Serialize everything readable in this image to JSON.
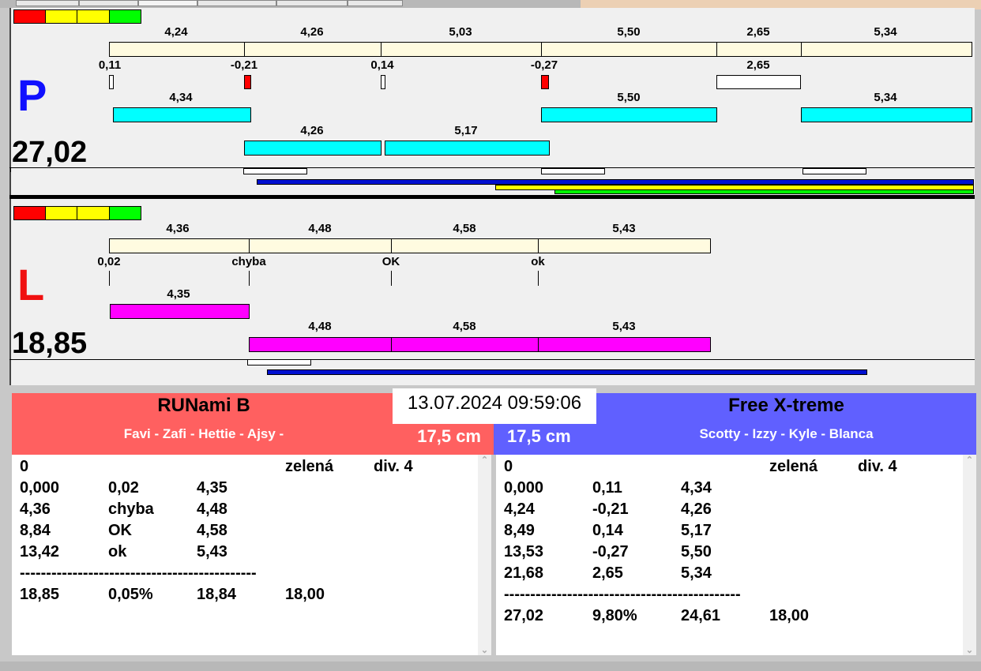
{
  "colors": {
    "red": "#ff0000",
    "yellow": "#ffff00",
    "green": "#00ff00",
    "cyan": "#00ffff",
    "magenta": "#ff00ff",
    "left_team": "#ff6060",
    "right_team": "#6060ff"
  },
  "P": {
    "side": "P",
    "total": "27,02",
    "segments": [
      "4,24",
      "4,26",
      "5,03",
      "5,50",
      "2,65",
      "5,34"
    ],
    "diffs": [
      "0,11",
      "-0,21",
      "0,14",
      "-0,27",
      "2,65"
    ],
    "row1": [
      "4,34",
      "5,50",
      "5,34"
    ],
    "row2": [
      "4,26",
      "5,17"
    ]
  },
  "L": {
    "side": "L",
    "total": "18,85",
    "segments": [
      "4,36",
      "4,48",
      "4,58",
      "5,43"
    ],
    "marks": [
      "0,02",
      "chyba",
      "OK",
      "ok"
    ],
    "row1": [
      "4,35"
    ],
    "row2": [
      "4,48",
      "4,58",
      "5,43"
    ]
  },
  "datetime": "13.07.2024 09:59:06",
  "left_team": {
    "name": "RUNami B",
    "members": "Favi - Zafi - Hettie - Ajsy -",
    "distance": "17,5 cm",
    "rows": [
      [
        "0",
        "",
        "",
        "zelená",
        "div. 4"
      ],
      [
        "0,000",
        "0,02",
        "4,35",
        "",
        ""
      ],
      [
        "4,36",
        "chyba",
        "4,48",
        "",
        ""
      ],
      [
        "8,84",
        "OK",
        "4,58",
        "",
        ""
      ],
      [
        "13,42",
        "ok",
        "5,43",
        "",
        ""
      ],
      [
        "---------------------------------------------",
        "",
        "",
        "",
        ""
      ],
      [
        "18,85",
        "0,05%",
        "18,84",
        "18,00",
        ""
      ]
    ]
  },
  "right_team": {
    "name": "Free X-treme",
    "members": "Scotty - Izzy - Kyle - Blanca",
    "distance": "17,5 cm",
    "rows": [
      [
        "0",
        "",
        "",
        "zelená",
        "div. 4"
      ],
      [
        "0,000",
        "0,11",
        "4,34",
        "",
        ""
      ],
      [
        "4,24",
        "-0,21",
        "4,26",
        "",
        ""
      ],
      [
        "8,49",
        "0,14",
        "5,17",
        "",
        ""
      ],
      [
        "13,53",
        "-0,27",
        "5,50",
        "",
        ""
      ],
      [
        "21,68",
        "2,65",
        "5,34",
        "",
        ""
      ],
      [
        "---------------------------------------------",
        "",
        "",
        "",
        ""
      ],
      [
        "27,02",
        "9,80%",
        "24,61",
        "18,00",
        ""
      ]
    ]
  }
}
